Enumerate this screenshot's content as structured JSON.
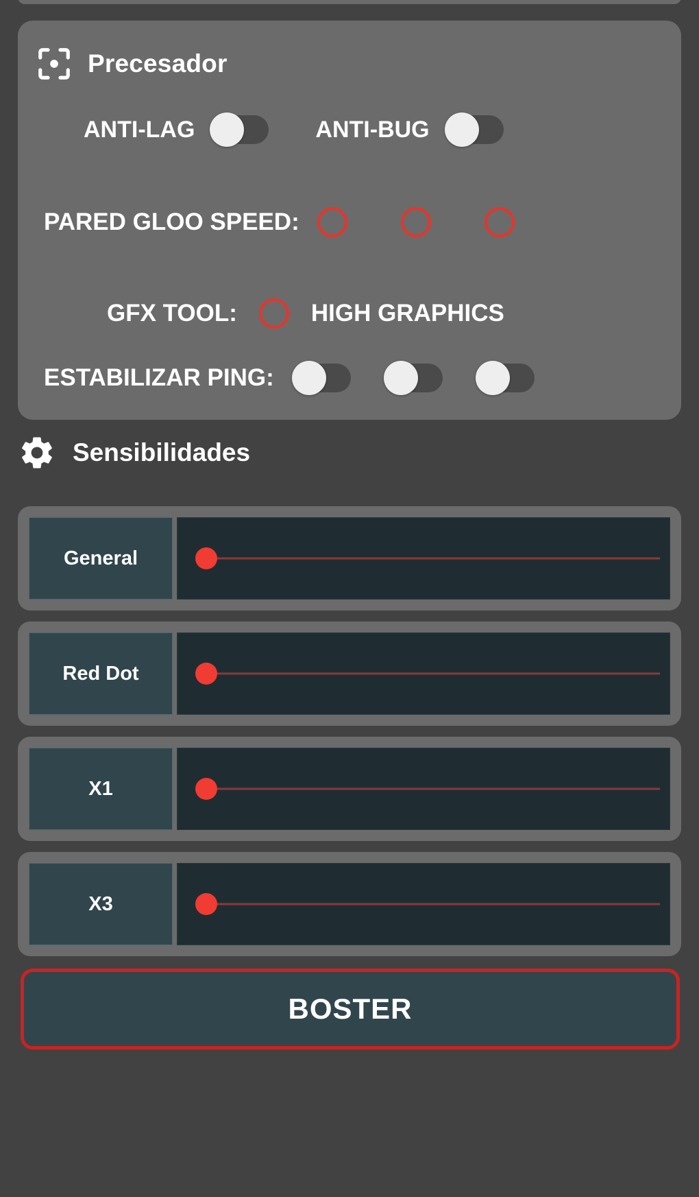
{
  "theme": {
    "page_bg": "#424242",
    "panel_bg": "#6b6b6b",
    "accent_red": "#e8342a",
    "slider_label_bg": "#31454d",
    "slider_track_bg": "#1f2d33",
    "text": "#ffffff"
  },
  "processor_panel": {
    "icon": "center-focus-icon",
    "title": "Precesador",
    "toggles": [
      {
        "label": "ANTI-LAG",
        "state": "off"
      },
      {
        "label": "ANTI-BUG",
        "state": "off"
      }
    ],
    "gloo_speed": {
      "label": "PARED GLOO SPEED:",
      "options": [
        {
          "selected": false
        },
        {
          "selected": false
        },
        {
          "selected": false
        }
      ]
    },
    "gfx_tool": {
      "label": "GFX TOOL:",
      "option_selected": false,
      "option_text": "HIGH GRAPHICS"
    },
    "stabilize_ping": {
      "label": "ESTABILIZAR PING:",
      "toggles": [
        {
          "state": "off"
        },
        {
          "state": "off"
        },
        {
          "state": "off"
        }
      ]
    }
  },
  "sensitivity_section": {
    "icon": "gear-icon",
    "title": "Sensibilidades",
    "sliders": [
      {
        "label": "General",
        "value": 0
      },
      {
        "label": "Red Dot",
        "value": 0
      },
      {
        "label": "X1",
        "value": 0
      },
      {
        "label": "X3",
        "value": 0
      }
    ]
  },
  "boster_button": {
    "label": "BOSTER"
  }
}
